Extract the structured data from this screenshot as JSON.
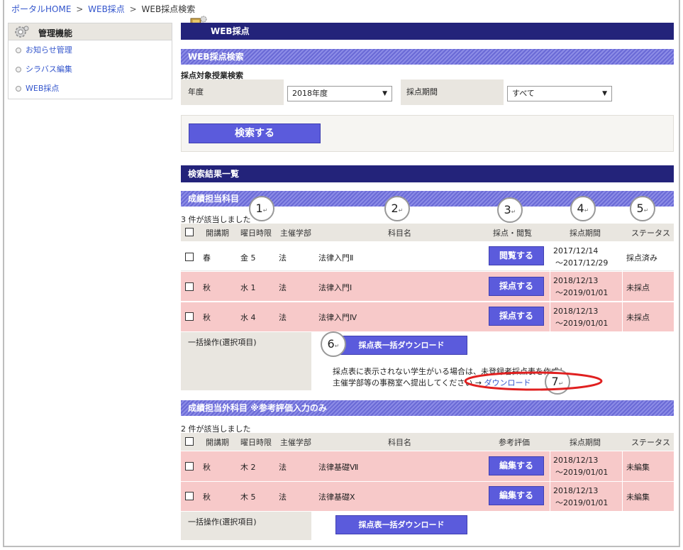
{
  "breadcrumb": {
    "home": "ポータルHOME",
    "web": "WEB採点",
    "current": "WEB採点検索",
    "sep": ">"
  },
  "sidebar": {
    "title": "管理機能",
    "items": [
      {
        "label": "お知らせ管理"
      },
      {
        "label": "シラバス編集"
      },
      {
        "label": "WEB採点"
      }
    ]
  },
  "header": {
    "title": "WEB採点"
  },
  "search": {
    "section_title": "WEB採点検索",
    "subtitle": "採点対象授業検索",
    "year_label": "年度",
    "year_value": "2018年度",
    "period_label": "採点期間",
    "period_value": "すべて",
    "search_button": "検索する",
    "arrow": "▼"
  },
  "results": {
    "title": "検索結果一覧"
  },
  "section1": {
    "title": "成績担当科目",
    "count": "3 件が該当しました",
    "headers": [
      "開講期",
      "曜日時限",
      "主催学部",
      "科目名",
      "採点・閲覧",
      "採点期間",
      "ステータス"
    ],
    "rows": [
      {
        "term": "春",
        "slot": "金 5",
        "dept": "法",
        "subject": "法律入門Ⅱ",
        "action": "閲覧する",
        "start": "2017/12/14",
        "end": "～2017/12/29",
        "status": "採点済み"
      },
      {
        "term": "秋",
        "slot": "水 1",
        "dept": "法",
        "subject": "法律入門Ⅰ",
        "action": "採点する",
        "start": "2018/12/13",
        "end": "～2019/01/01",
        "status": "未採点"
      },
      {
        "term": "秋",
        "slot": "水 4",
        "dept": "法",
        "subject": "法律入門Ⅳ",
        "action": "採点する",
        "start": "2018/12/13",
        "end": "～2019/01/01",
        "status": "未採点"
      }
    ],
    "bulk_label": "一括操作(選択項目)",
    "bulk_button": "採点表一括ダウンロード",
    "note_line1": "採点表に表示されない学生がいる場合は、未登録者採点表を作成し、",
    "note_line2": "主催学部等の事務室へ提出してください",
    "note_arrow": "→",
    "download_link": "ダウンロード"
  },
  "section2": {
    "title": "成績担当外科目 ※参考評価入力のみ",
    "count": "2 件が該当しました",
    "headers": [
      "開講期",
      "曜日時限",
      "主催学部",
      "科目名",
      "参考評価",
      "採点期間",
      "ステータス"
    ],
    "rows": [
      {
        "term": "秋",
        "slot": "木 2",
        "dept": "法",
        "subject": "法律基礎Ⅶ",
        "action": "編集する",
        "start": "2018/12/13",
        "end": "～2019/01/01",
        "status": "未編集"
      },
      {
        "term": "秋",
        "slot": "木 5",
        "dept": "法",
        "subject": "法律基礎Ⅹ",
        "action": "編集する",
        "start": "2018/12/13",
        "end": "～2019/01/01",
        "status": "未編集"
      }
    ],
    "bulk_label": "一括操作(選択項目)",
    "bulk_button": "採点表一括ダウンロード"
  },
  "callouts": [
    "1",
    "2",
    "3",
    "4",
    "5",
    "6",
    "7"
  ],
  "colors": {
    "navy": "#23237a",
    "stripe": "#7a7ade",
    "button": "#5b5bdc",
    "pink_row": "#f7c9c9",
    "grey_cell": "#e9e6e0",
    "red_ellipse": "#e02020"
  }
}
